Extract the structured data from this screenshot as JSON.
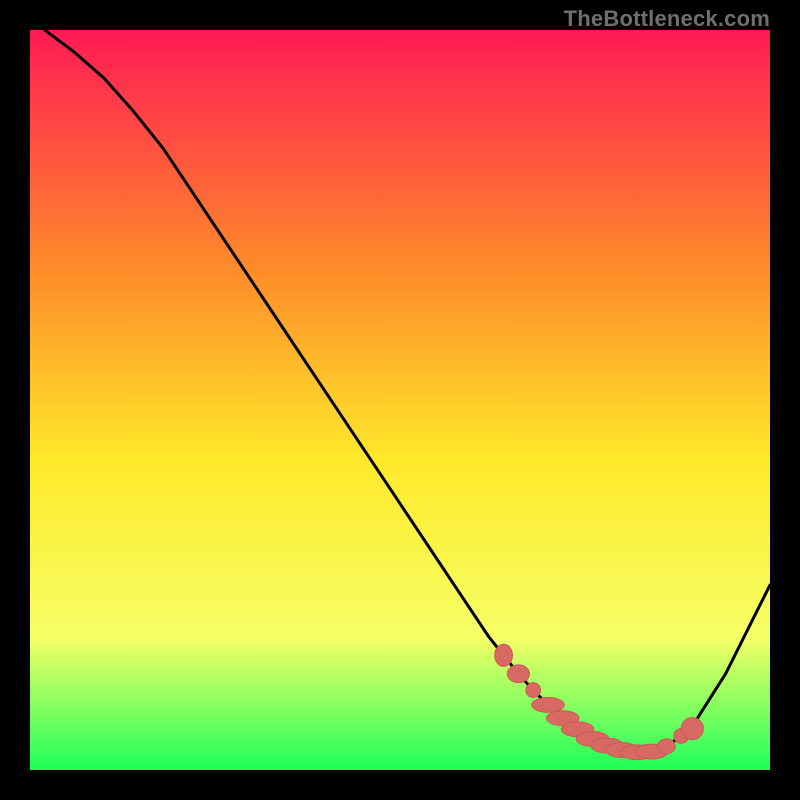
{
  "watermark": "TheBottleneck.com",
  "colors": {
    "gradient_top": "#ff1a55",
    "gradient_mid_upper": "#ff8a2a",
    "gradient_mid": "#ffe92a",
    "gradient_lower": "#f6ff66",
    "gradient_bottom": "#1dff5a",
    "curve": "#000000",
    "marker_fill": "#d96a63",
    "marker_stroke": "#c95a55",
    "plot_border": "#000000"
  },
  "chart_data": {
    "type": "line",
    "title": "",
    "xlabel": "",
    "ylabel": "",
    "xlim": [
      0,
      100
    ],
    "ylim": [
      0,
      100
    ],
    "grid": false,
    "legend": false,
    "series": [
      {
        "name": "bottleneck-curve",
        "x": [
          2,
          6,
          10,
          14,
          18,
          22,
          26,
          30,
          34,
          38,
          42,
          46,
          50,
          54,
          58,
          62,
          64,
          66,
          68,
          70,
          72,
          74,
          76,
          78,
          80,
          82,
          84,
          86,
          88,
          90,
          94,
          98,
          100
        ],
        "y": [
          100,
          97,
          93.5,
          89,
          84,
          78,
          72,
          66,
          60,
          54,
          48,
          42,
          36,
          30,
          24,
          18,
          15.5,
          13,
          10.8,
          8.8,
          7,
          5.5,
          4.2,
          3.3,
          2.7,
          2.4,
          2.5,
          3.2,
          4.6,
          6.7,
          13,
          21,
          25
        ]
      }
    ],
    "markers": {
      "name": "highlight-points",
      "x": [
        64,
        66,
        68,
        70,
        72,
        74,
        76,
        78,
        80,
        82,
        84,
        86,
        88,
        89.5
      ],
      "y": [
        15.5,
        13,
        10.8,
        8.8,
        7,
        5.5,
        4.2,
        3.3,
        2.7,
        2.4,
        2.5,
        3.2,
        4.6,
        5.6
      ],
      "rx": [
        1.2,
        1.5,
        1.0,
        2.2,
        2.2,
        2.2,
        2.2,
        2.2,
        2.2,
        2.2,
        2.2,
        1.2,
        1.0,
        1.5
      ],
      "ry": [
        1.5,
        1.2,
        1.0,
        1.0,
        1.0,
        1.0,
        1.0,
        1.0,
        1.0,
        1.0,
        1.0,
        1.0,
        1.0,
        1.5
      ]
    }
  }
}
